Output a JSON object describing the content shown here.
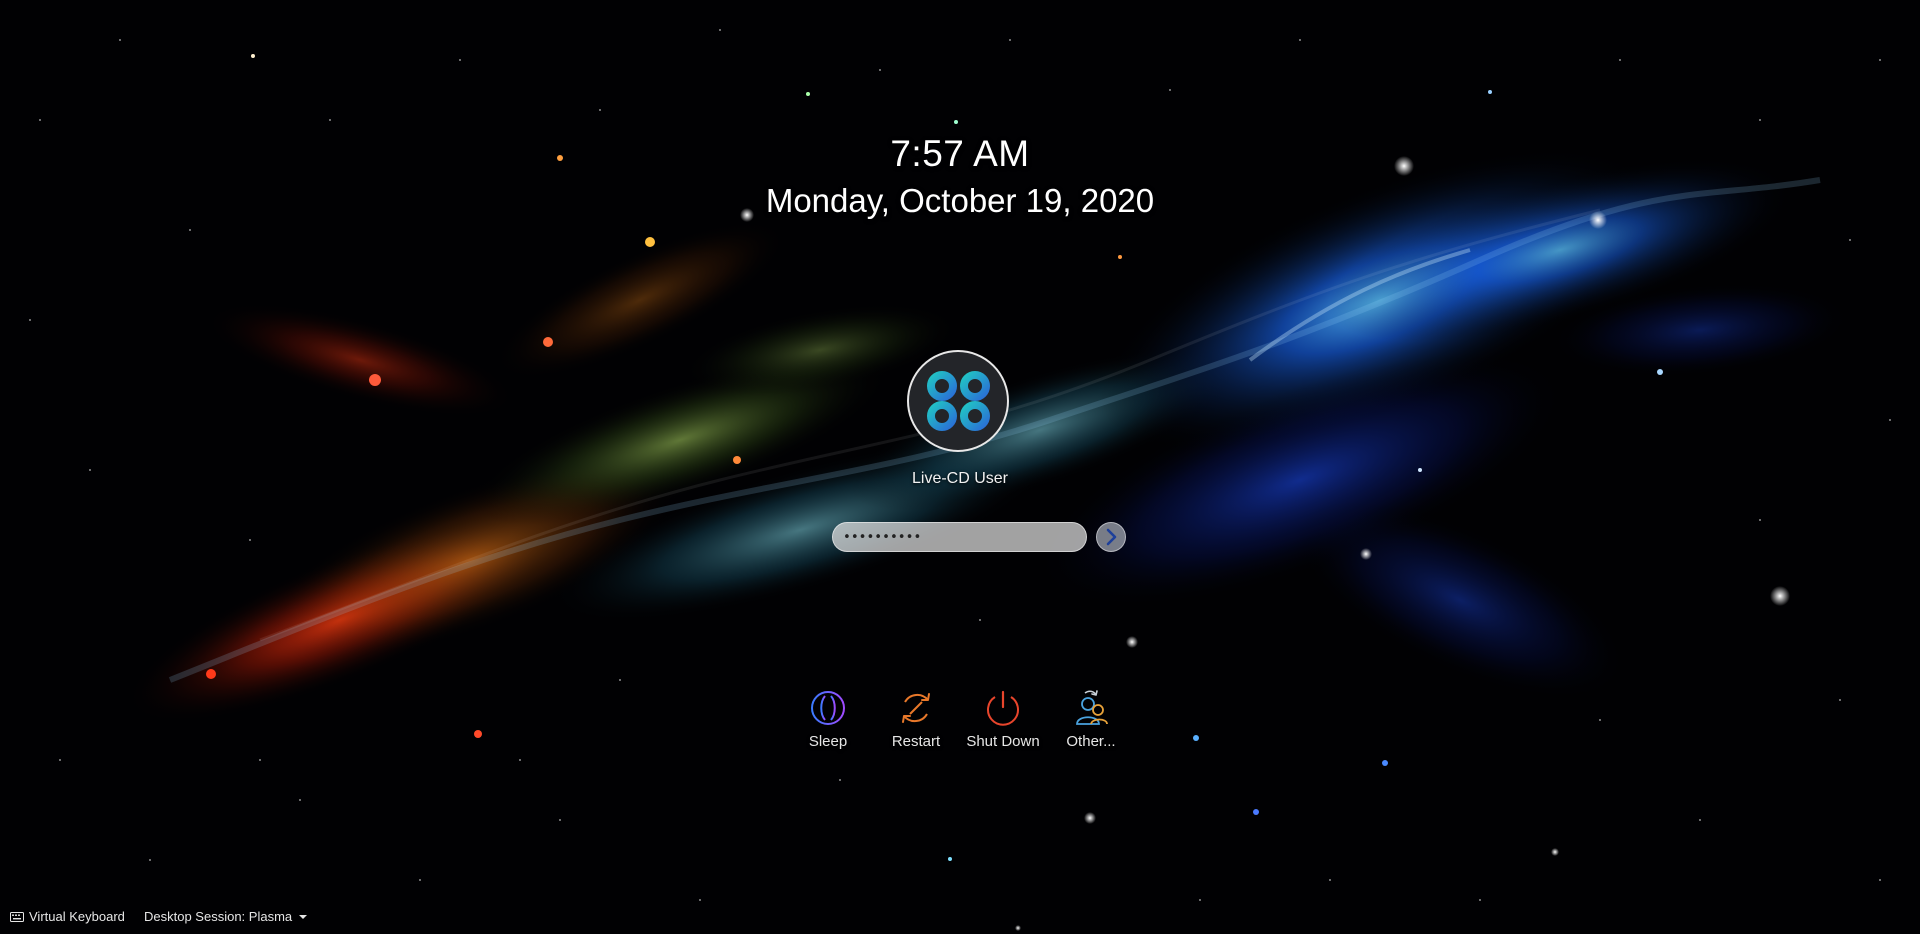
{
  "clock": {
    "time": "7:57 AM",
    "date": "Monday, October 19, 2020"
  },
  "user": {
    "name": "Live-CD User",
    "avatar_icon": "logo-avatar-icon"
  },
  "password": {
    "value": "••••••••••"
  },
  "login_button": {
    "icon": "arrow-right-icon"
  },
  "actions": [
    {
      "label": "Sleep",
      "icon": "sleep-icon",
      "color": "#7c5cff"
    },
    {
      "label": "Restart",
      "icon": "restart-icon",
      "color": "#e8782a"
    },
    {
      "label": "Shut Down",
      "icon": "power-icon",
      "color": "#e8452c"
    },
    {
      "label": "Other...",
      "icon": "switch-user-icon",
      "color": "#4aa3df"
    }
  ],
  "footer": {
    "virtual_keyboard_label": "Virtual Keyboard",
    "session_label": "Desktop Session: Plasma"
  },
  "colors": {
    "accent_teal": "#1fa8b5",
    "accent_blue": "#2f6bd8",
    "text": "#ffffff"
  }
}
